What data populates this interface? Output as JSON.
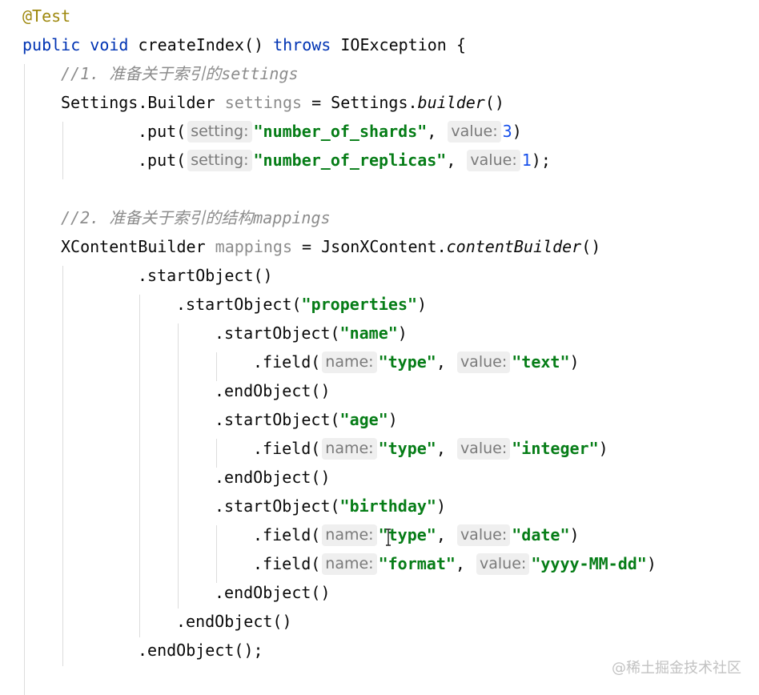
{
  "code": {
    "lines": [
      {
        "indent": 28,
        "tokens": [
          {
            "t": "@Test",
            "c": "annotation"
          }
        ]
      },
      {
        "indent": 28,
        "tokens": [
          {
            "t": "public void ",
            "c": "keyword"
          },
          {
            "t": "createIndex() ",
            "c": "plain"
          },
          {
            "t": "throws ",
            "c": "keyword"
          },
          {
            "t": "IOException {",
            "c": "plain"
          }
        ]
      },
      {
        "indent": 76,
        "tokens": [
          {
            "t": "//1. 准备关于索引的settings",
            "c": "comment"
          }
        ]
      },
      {
        "indent": 76,
        "tokens": [
          {
            "t": "Settings.Builder ",
            "c": "plain"
          },
          {
            "t": "settings",
            "c": "unused"
          },
          {
            "t": " = Settings.",
            "c": "plain"
          },
          {
            "t": "builder",
            "c": "static"
          },
          {
            "t": "()",
            "c": "plain"
          }
        ]
      },
      {
        "indent": 172,
        "tokens": [
          {
            "t": ".put(",
            "c": "plain"
          },
          {
            "t": "setting:",
            "c": "hint"
          },
          {
            "t": "\"number_of_shards\"",
            "c": "string"
          },
          {
            "t": ", ",
            "c": "plain"
          },
          {
            "t": "value:",
            "c": "hint"
          },
          {
            "t": "3",
            "c": "number"
          },
          {
            "t": ")",
            "c": "plain"
          }
        ]
      },
      {
        "indent": 172,
        "tokens": [
          {
            "t": ".put(",
            "c": "plain"
          },
          {
            "t": "setting:",
            "c": "hint"
          },
          {
            "t": "\"number_of_replicas\"",
            "c": "string"
          },
          {
            "t": ", ",
            "c": "plain"
          },
          {
            "t": "value:",
            "c": "hint"
          },
          {
            "t": "1",
            "c": "number"
          },
          {
            "t": ");",
            "c": "plain"
          }
        ]
      },
      {
        "indent": 76,
        "tokens": []
      },
      {
        "indent": 76,
        "tokens": [
          {
            "t": "//2. 准备关于索引的结构mappings",
            "c": "comment"
          }
        ]
      },
      {
        "indent": 76,
        "tokens": [
          {
            "t": "XContentBuilder ",
            "c": "plain"
          },
          {
            "t": "mappings",
            "c": "unused"
          },
          {
            "t": " = JsonXContent.",
            "c": "plain"
          },
          {
            "t": "contentBuilder",
            "c": "static"
          },
          {
            "t": "()",
            "c": "plain"
          }
        ]
      },
      {
        "indent": 172,
        "tokens": [
          {
            "t": ".startObject()",
            "c": "plain"
          }
        ]
      },
      {
        "indent": 220,
        "tokens": [
          {
            "t": ".startObject(",
            "c": "plain"
          },
          {
            "t": "\"properties\"",
            "c": "string"
          },
          {
            "t": ")",
            "c": "plain"
          }
        ]
      },
      {
        "indent": 268,
        "tokens": [
          {
            "t": ".startObject(",
            "c": "plain"
          },
          {
            "t": "\"name\"",
            "c": "string"
          },
          {
            "t": ")",
            "c": "plain"
          }
        ]
      },
      {
        "indent": 316,
        "tokens": [
          {
            "t": ".field(",
            "c": "plain"
          },
          {
            "t": "name:",
            "c": "hint"
          },
          {
            "t": "\"type\"",
            "c": "string"
          },
          {
            "t": ", ",
            "c": "plain"
          },
          {
            "t": "value:",
            "c": "hint"
          },
          {
            "t": "\"text\"",
            "c": "string"
          },
          {
            "t": ")",
            "c": "plain"
          }
        ]
      },
      {
        "indent": 268,
        "tokens": [
          {
            "t": ".endObject()",
            "c": "plain"
          }
        ]
      },
      {
        "indent": 268,
        "tokens": [
          {
            "t": ".startObject(",
            "c": "plain"
          },
          {
            "t": "\"age\"",
            "c": "string"
          },
          {
            "t": ")",
            "c": "plain"
          }
        ]
      },
      {
        "indent": 316,
        "tokens": [
          {
            "t": ".field(",
            "c": "plain"
          },
          {
            "t": "name:",
            "c": "hint"
          },
          {
            "t": "\"type\"",
            "c": "string"
          },
          {
            "t": ", ",
            "c": "plain"
          },
          {
            "t": "value:",
            "c": "hint"
          },
          {
            "t": "\"integer\"",
            "c": "string"
          },
          {
            "t": ")",
            "c": "plain"
          }
        ]
      },
      {
        "indent": 268,
        "tokens": [
          {
            "t": ".endObject()",
            "c": "plain"
          }
        ]
      },
      {
        "indent": 268,
        "tokens": [
          {
            "t": ".startObject(",
            "c": "plain"
          },
          {
            "t": "\"birthday\"",
            "c": "string"
          },
          {
            "t": ")",
            "c": "plain"
          }
        ]
      },
      {
        "indent": 316,
        "tokens": [
          {
            "t": ".field(",
            "c": "plain"
          },
          {
            "t": "name:",
            "c": "hint"
          },
          {
            "t": "\"type\"",
            "c": "string"
          },
          {
            "t": ", ",
            "c": "plain"
          },
          {
            "t": "value:",
            "c": "hint"
          },
          {
            "t": "\"date\"",
            "c": "string"
          },
          {
            "t": ")",
            "c": "plain"
          }
        ]
      },
      {
        "indent": 316,
        "tokens": [
          {
            "t": ".field(",
            "c": "plain"
          },
          {
            "t": "name:",
            "c": "hint"
          },
          {
            "t": "\"format\"",
            "c": "string"
          },
          {
            "t": ", ",
            "c": "plain"
          },
          {
            "t": "value:",
            "c": "hint"
          },
          {
            "t": "\"yyyy-MM-dd\"",
            "c": "string"
          },
          {
            "t": ")",
            "c": "plain"
          }
        ]
      },
      {
        "indent": 268,
        "tokens": [
          {
            "t": ".endObject()",
            "c": "plain"
          }
        ]
      },
      {
        "indent": 220,
        "tokens": [
          {
            "t": ".endObject()",
            "c": "plain"
          }
        ]
      },
      {
        "indent": 172,
        "tokens": [
          {
            "t": ".endObject();",
            "c": "plain"
          }
        ]
      }
    ]
  },
  "watermark": "@稀土掘金技术社区",
  "colors": {
    "background": "#ffffff",
    "keyword": "#0033b3",
    "annotation": "#9e880d",
    "string": "#067d17",
    "number": "#1750eb",
    "comment": "#8c8c8c",
    "hint_background": "#efefef"
  },
  "icons": {
    "cursor": "text-cursor-icon"
  }
}
